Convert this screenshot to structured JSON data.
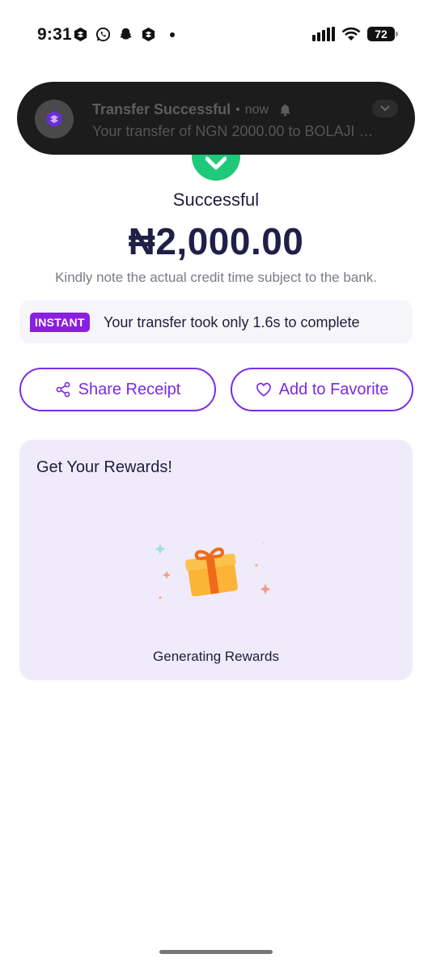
{
  "status_bar": {
    "time": "9:31",
    "battery": "72",
    "icons": [
      "app-icon",
      "whatsapp-icon",
      "snapchat-icon",
      "app-icon",
      "dot-icon",
      "signal-icon",
      "wifi-icon",
      "battery-icon"
    ]
  },
  "notification": {
    "title": "Transfer Successful",
    "separator": "•",
    "time": "now",
    "body": "Your transfer of NGN 2000.00 to BOLAJI …",
    "icons": [
      "app-logo-icon",
      "bell-icon",
      "chevron-down-icon"
    ]
  },
  "transfer": {
    "status": "Successful",
    "amount": "₦2,000.00",
    "note": "Kindly note the actual credit time subject to the bank."
  },
  "instant": {
    "badge": "INSTANT",
    "text": "Your transfer took only 1.6s to complete"
  },
  "actions": {
    "share_label": "Share Receipt",
    "favorite_label": "Add to Favorite",
    "icons": [
      "share-icon",
      "heart-icon"
    ]
  },
  "rewards": {
    "title": "Get Your Rewards!",
    "status": "Generating Rewards",
    "icons": [
      "gift-icon"
    ]
  },
  "colors": {
    "accent": "#7b2ee8",
    "success": "#1fc97a",
    "instant_badge": "#8a1fe0",
    "rewards_bg": "#efebfa",
    "gift": "#fbb437",
    "ribbon": "#f06a1b"
  }
}
